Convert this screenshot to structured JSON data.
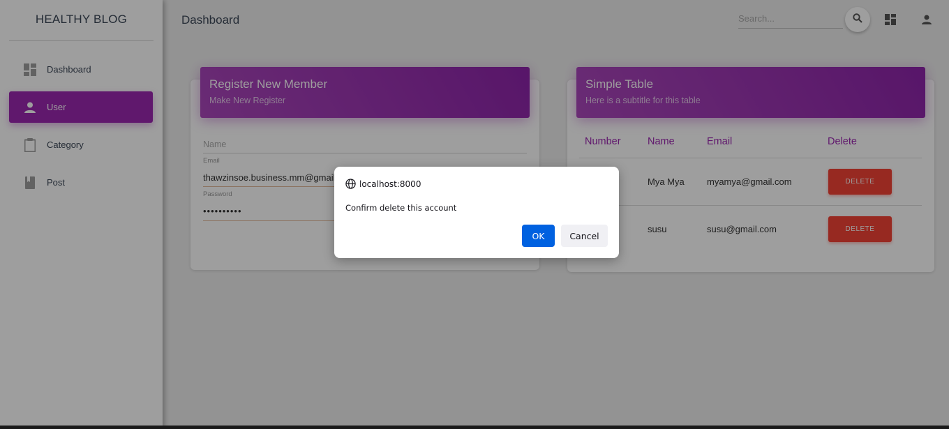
{
  "sidebar": {
    "brand": "HEALTHY BLOG",
    "items": [
      {
        "label": "Dashboard",
        "icon": "dashboard-icon"
      },
      {
        "label": "User",
        "icon": "person-icon",
        "active": true
      },
      {
        "label": "Category",
        "icon": "clipboard-icon"
      },
      {
        "label": "Post",
        "icon": "book-icon"
      }
    ]
  },
  "header": {
    "title": "Dashboard",
    "search_placeholder": "Search...",
    "icons": [
      "search-icon",
      "dashboard-icon",
      "person-icon"
    ]
  },
  "register_card": {
    "title": "Register New Member",
    "subtitle": "Make New Register",
    "name_placeholder": "Name",
    "email_label": "Email",
    "email_value": "thawzinsoe.business.mm@gmail.",
    "password_label": "Password",
    "password_value": "••••••••••"
  },
  "table_card": {
    "title": "Simple Table",
    "subtitle": "Here is a subtitle for this table",
    "columns": [
      "Number",
      "Name",
      "Email",
      "Delete"
    ],
    "rows": [
      {
        "name": "Mya Mya",
        "email": "myamya@gmail.com",
        "action": "DELETE"
      },
      {
        "name": "susu",
        "email": "susu@gmail.com",
        "action": "DELETE"
      }
    ]
  },
  "dialog": {
    "origin": "localhost:8000",
    "message": "Confirm delete this account",
    "ok_label": "OK",
    "cancel_label": "Cancel"
  },
  "colors": {
    "accent": "#9c27b0",
    "danger": "#f44336",
    "dialog_primary": "#0061e0"
  }
}
